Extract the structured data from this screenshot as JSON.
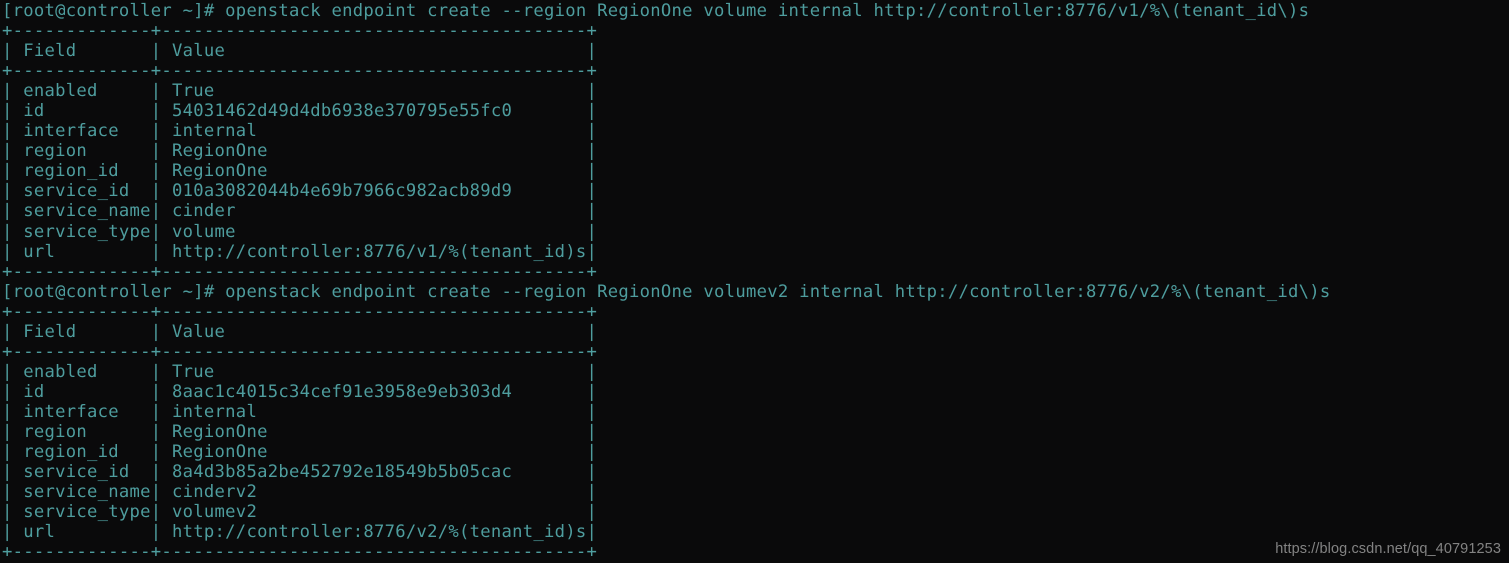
{
  "terminal": {
    "background_color": "#0a0a0b",
    "foreground_color": "#4e9d9e",
    "watermark_color": "#8e8e8e",
    "prompt": "[root@controller ~]# ",
    "watermark": "https://blog.csdn.net/qq_40791253",
    "table": {
      "field_column_width": 13,
      "value_column_width": 40,
      "separator_line": "+-------------+----------------------------------------+",
      "header_field": "Field",
      "header_value": "Value"
    },
    "blocks": [
      {
        "command": "openstack endpoint create --region RegionOne volume internal http://controller:8776/v1/%\\(tenant_id\\)s",
        "rows": [
          {
            "field": "enabled",
            "value": "True"
          },
          {
            "field": "id",
            "value": "54031462d49d4db6938e370795e55fc0"
          },
          {
            "field": "interface",
            "value": "internal"
          },
          {
            "field": "region",
            "value": "RegionOne"
          },
          {
            "field": "region_id",
            "value": "RegionOne"
          },
          {
            "field": "service_id",
            "value": "010a3082044b4e69b7966c982acb89d9"
          },
          {
            "field": "service_name",
            "value": "cinder"
          },
          {
            "field": "service_type",
            "value": "volume"
          },
          {
            "field": "url",
            "value": "http://controller:8776/v1/%(tenant_id)s"
          }
        ]
      },
      {
        "command": "openstack endpoint create --region RegionOne volumev2 internal http://controller:8776/v2/%\\(tenant_id\\)s",
        "rows": [
          {
            "field": "enabled",
            "value": "True"
          },
          {
            "field": "id",
            "value": "8aac1c4015c34cef91e3958e9eb303d4"
          },
          {
            "field": "interface",
            "value": "internal"
          },
          {
            "field": "region",
            "value": "RegionOne"
          },
          {
            "field": "region_id",
            "value": "RegionOne"
          },
          {
            "field": "service_id",
            "value": "8a4d3b85a2be452792e18549b5b05cac"
          },
          {
            "field": "service_name",
            "value": "cinderv2"
          },
          {
            "field": "service_type",
            "value": "volumev2"
          },
          {
            "field": "url",
            "value": "http://controller:8776/v2/%(tenant_id)s"
          }
        ]
      }
    ]
  }
}
